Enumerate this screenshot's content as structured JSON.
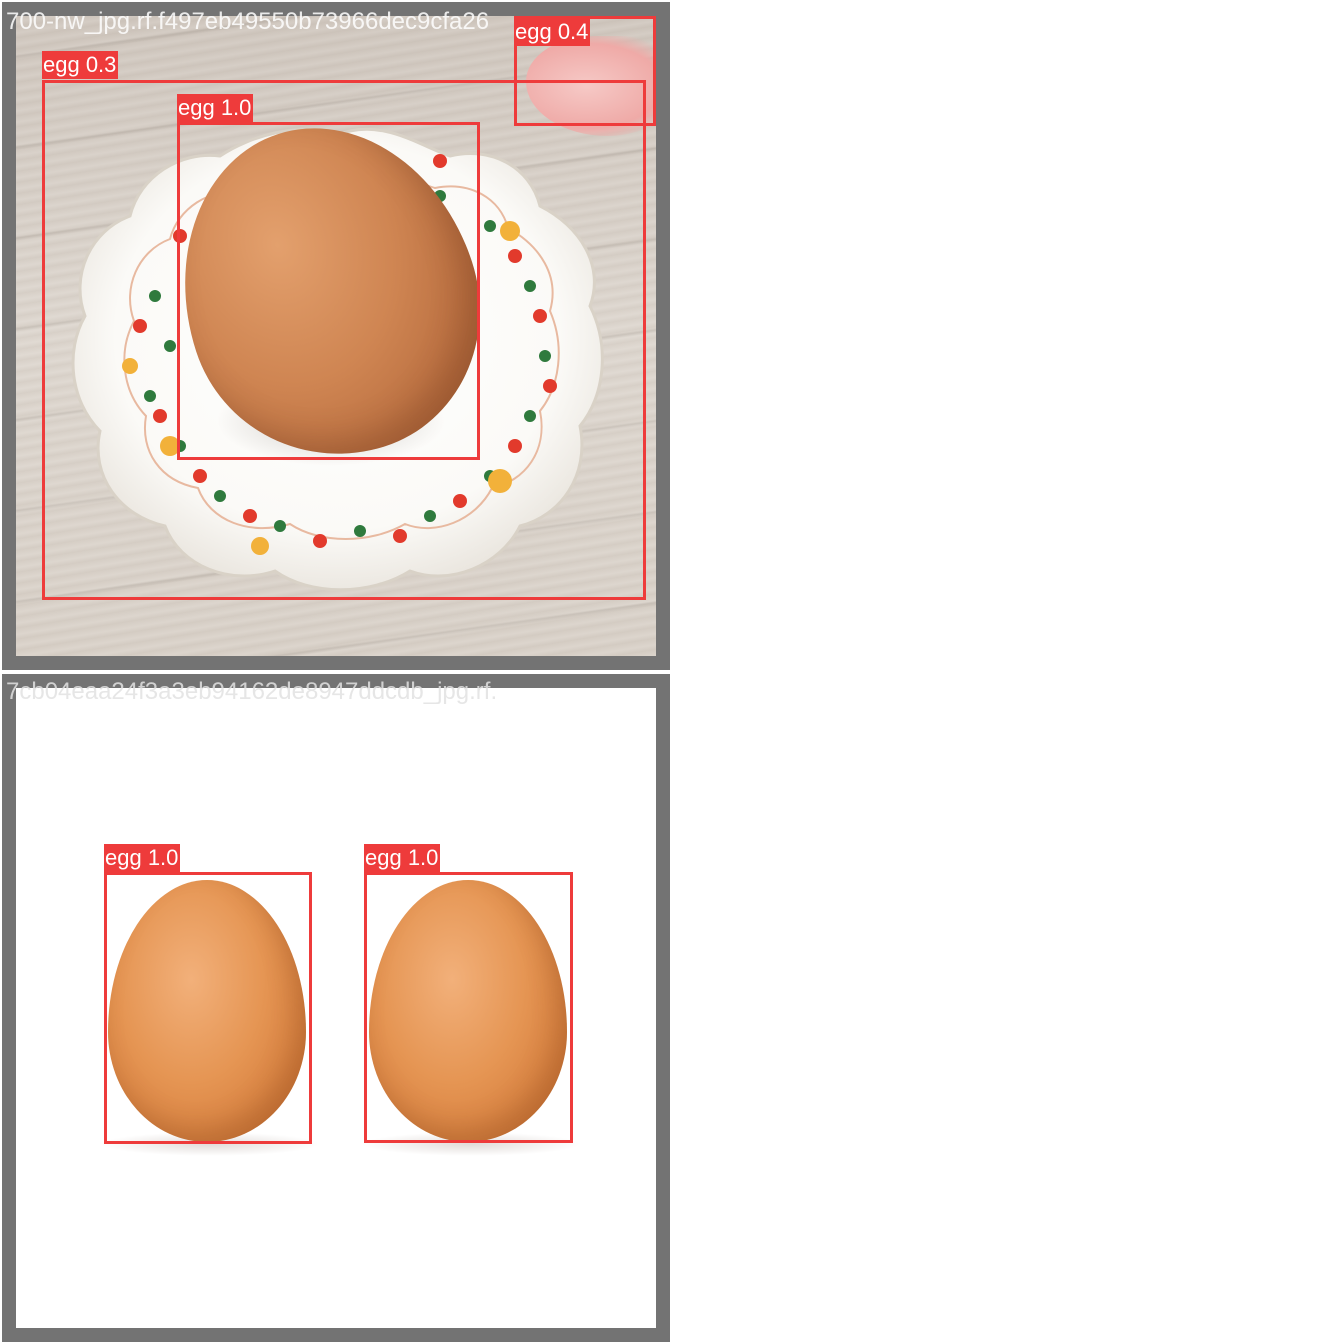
{
  "tiles": [
    {
      "filename": "700-nw_jpg.rf.f497eb49550b73966dec9cfa26",
      "detections": [
        {
          "label": "egg 0.3"
        },
        {
          "label": "egg 1.0"
        },
        {
          "label": "egg 0.4"
        }
      ]
    },
    {
      "filename": "7cb04eaa24f3a3eb94162de8947ddcdb_jpg.rf.",
      "detections": [
        {
          "label": "egg 1.0"
        },
        {
          "label": "egg 1.0"
        }
      ]
    }
  ],
  "colors": {
    "box": "#ee3b3b",
    "tile_border": "#737373"
  }
}
